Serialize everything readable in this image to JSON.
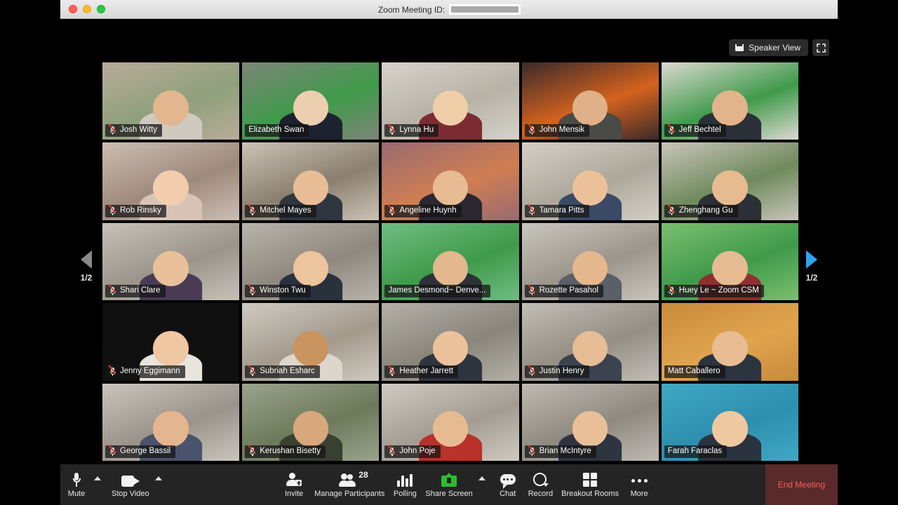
{
  "window": {
    "title_prefix": "Zoom Meeting ID:",
    "meeting_id_value": "",
    "traffic_lights": [
      "close-red",
      "minimize-yellow",
      "zoom-green"
    ]
  },
  "view_controls": {
    "speaker_view_label": "Speaker View",
    "grid_icon": "grid-view-icon",
    "fullscreen_icon": "enter-fullscreen-icon"
  },
  "pager": {
    "left_label": "1/2",
    "right_label": "1/2",
    "left_arrow_color": "#8a8a8a",
    "right_arrow_color": "#2fa4f0"
  },
  "gallery": {
    "columns": 5,
    "rows": 5,
    "active_speaker": "Farah Faraclas",
    "active_border_color": "#cddc6a",
    "participants": [
      {
        "name": "Josh Witty",
        "muted": true,
        "bg": "#b9ac9a",
        "skin": "#e2b78f",
        "shirt": "#cfcac0",
        "accent": "#8fa07c"
      },
      {
        "name": "Elizabeth Swan",
        "muted": false,
        "bg": "#7e8578",
        "skin": "#eccfae",
        "shirt": "#1d2230",
        "accent": "#3f9a4a"
      },
      {
        "name": "Lynna Hu",
        "muted": true,
        "bg": "#d6d3cb",
        "skin": "#f0cfa8",
        "shirt": "#7d2b33",
        "accent": "#b8b2a6"
      },
      {
        "name": "John Mensik",
        "muted": true,
        "bg": "#3a2a2a",
        "skin": "#e0b089",
        "shirt": "#4a4a46",
        "accent": "#d4621e"
      },
      {
        "name": "Jeff Bechtel",
        "muted": true,
        "bg": "#ddd9d2",
        "skin": "#e3b48c",
        "shirt": "#2c3038",
        "accent": "#3f9a4a"
      },
      {
        "name": "Rob Rinsky",
        "muted": true,
        "bg": "#cdbdb2",
        "skin": "#f2cdae",
        "shirt": "#d8c4b6",
        "accent": "#9d8a7c"
      },
      {
        "name": "Mitchel Mayes",
        "muted": true,
        "bg": "#cbc3b6",
        "skin": "#e8bd96",
        "shirt": "#2f3640",
        "accent": "#8b7f6e"
      },
      {
        "name": "Angeline Huynh",
        "muted": true,
        "bg": "#9a6a72",
        "skin": "#e7bb93",
        "shirt": "#2a2730",
        "accent": "#cf7e52"
      },
      {
        "name": "Tamara Pitts",
        "muted": true,
        "bg": "#d4cfc6",
        "skin": "#ecc19a",
        "shirt": "#3a4a66",
        "accent": "#aea79b"
      },
      {
        "name": "Zhenghang Gu",
        "muted": true,
        "bg": "#c9c4ba",
        "skin": "#e6bb90",
        "shirt": "#2b2f36",
        "accent": "#6f8a5c"
      },
      {
        "name": "Shari Clare",
        "muted": true,
        "bg": "#c6c2b8",
        "skin": "#e9c09a",
        "shirt": "#4a3b55",
        "accent": "#9b948a"
      },
      {
        "name": "Winston Twu",
        "muted": true,
        "bg": "#b9b4ab",
        "skin": "#ecc49d",
        "shirt": "#29313d",
        "accent": "#8e887e"
      },
      {
        "name": "James Desmond~ Denve...",
        "muted": false,
        "bg": "#6fbd82",
        "skin": "#e3b88f",
        "shirt": "#2d3239",
        "accent": "#3f9a4a"
      },
      {
        "name": "Rozette Pasahol",
        "muted": true,
        "bg": "#cac6bd",
        "skin": "#e5b78d",
        "shirt": "#5a5f68",
        "accent": "#9c958b"
      },
      {
        "name": "Huey Le ~ Zoom CSM",
        "muted": true,
        "bg": "#7bbf6f",
        "skin": "#e6bb92",
        "shirt": "#8f2f2f",
        "accent": "#3f9a4a"
      },
      {
        "name": "Jenny Eggimann",
        "muted": true,
        "bg": "#c8c4bb",
        "skin": "#efc7a2",
        "shirt": "#e8e4de",
        "accent": "#9a9views"
      },
      {
        "name": "Subriah Esharc",
        "muted": true,
        "bg": "#cfcac1",
        "skin": "#c9945f",
        "shirt": "#dcd6cc",
        "accent": "#a39a8c"
      },
      {
        "name": "Heather Jarrett",
        "muted": true,
        "bg": "#b4b0a7",
        "skin": "#ebc29c",
        "shirt": "#2f3540",
        "accent": "#8a857b"
      },
      {
        "name": "Justin Henry",
        "muted": true,
        "bg": "#c2beb5",
        "skin": "#e7bd95",
        "shirt": "#3b4350",
        "accent": "#948e84"
      },
      {
        "name": "Matt Caballero",
        "muted": false,
        "bg": "#c98a3a",
        "skin": "#e8bd93",
        "shirt": "#2c3440",
        "accent": "#e0a44e"
      },
      {
        "name": "George Bassil",
        "muted": true,
        "bg": "#cac5bc",
        "skin": "#e4b690",
        "shirt": "#49536b",
        "accent": "#9a938a"
      },
      {
        "name": "Kerushan Bisetty",
        "muted": true,
        "bg": "#9aa38e",
        "skin": "#d8a87c",
        "shirt": "#3a4030",
        "accent": "#6d7a5a"
      },
      {
        "name": "John Poje",
        "muted": true,
        "bg": "#cfcac1",
        "skin": "#e7bb92",
        "shirt": "#b8312a",
        "accent": "#a39c92"
      },
      {
        "name": "Brian McIntyre",
        "muted": true,
        "bg": "#bfbab1",
        "skin": "#e9bf98",
        "shirt": "#2e3440",
        "accent": "#8f8a80"
      },
      {
        "name": "Farah Faraclas",
        "muted": false,
        "bg": "#3fa8c4",
        "skin": "#f0c8a0",
        "shirt": "#2b3340",
        "accent": "#2d8fae"
      }
    ]
  },
  "toolbar": {
    "items": [
      {
        "label": "Mute",
        "icon": "microphone-icon",
        "caret": true
      },
      {
        "label": "Stop Video",
        "icon": "video-camera-icon",
        "caret": true
      },
      {
        "label": "Invite",
        "icon": "invite-person-icon",
        "caret": false
      },
      {
        "label": "Manage Participants",
        "icon": "participants-icon",
        "caret": false,
        "badge": "28"
      },
      {
        "label": "Polling",
        "icon": "polling-bars-icon",
        "caret": false
      },
      {
        "label": "Share Screen",
        "icon": "share-screen-icon",
        "caret": true
      },
      {
        "label": "Chat",
        "icon": "chat-bubble-icon",
        "caret": false
      },
      {
        "label": "Record",
        "icon": "record-circle-icon",
        "caret": false
      },
      {
        "label": "Breakout Rooms",
        "icon": "breakout-rooms-icon",
        "caret": false
      },
      {
        "label": "More",
        "icon": "more-dots-icon",
        "caret": false
      }
    ],
    "end_meeting_label": "End Meeting",
    "end_meeting_color": "#ff5b5b",
    "participant_count": "28"
  }
}
